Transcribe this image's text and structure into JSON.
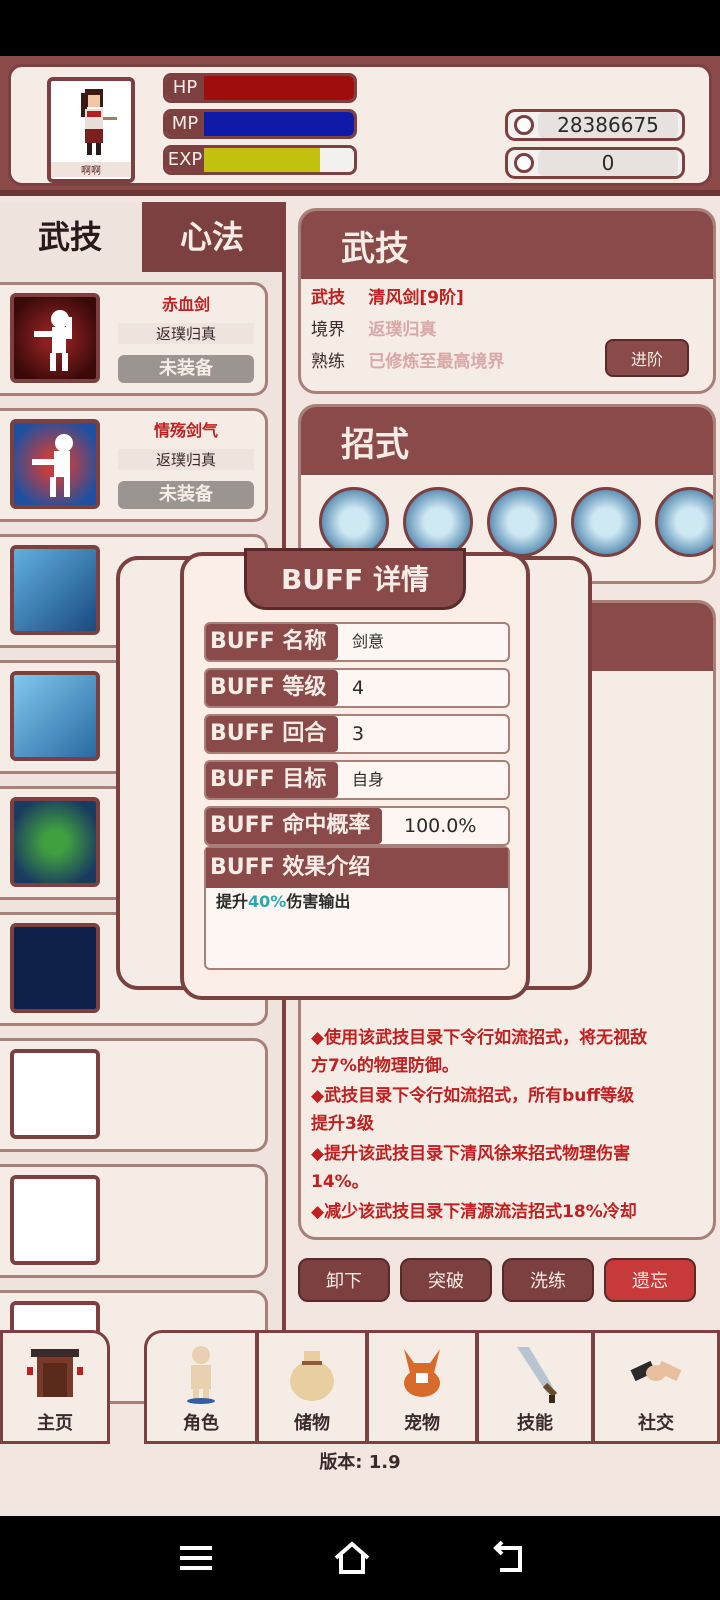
{
  "header": {
    "avatar_name": "啊啊",
    "bars": [
      {
        "label": "HP",
        "color": "#a00d0d",
        "fill": 1.0
      },
      {
        "label": "MP",
        "color": "#0f1aa8",
        "fill": 1.0
      },
      {
        "label": "EXP",
        "color": "#c3c20e",
        "fill": 0.77
      }
    ],
    "gold": "28386675",
    "gems": "0"
  },
  "left_tabs": {
    "active": "武技",
    "inactive": "心法"
  },
  "skills": [
    {
      "title": "赤血剑",
      "realm": "返璞归真",
      "status": "未装备"
    },
    {
      "title": "情殇剑气",
      "realm": "返璞归真",
      "status": "未装备"
    }
  ],
  "skill_section": {
    "heading": "武技",
    "row1_key": "武技",
    "row1_val": "清风剑[9阶]",
    "row2_key": "境界",
    "row2_val": "返璞归真",
    "row3_key": "熟练",
    "row3_val": "已修炼至最高境界",
    "upgrade": "进阶"
  },
  "moves_section": {
    "heading": "招式"
  },
  "effects": [
    "◆使用该武技目录下令行如流招式，将无视敌",
    "方7%的物理防御。",
    "◆武技目录下令行如流招式，所有buff等级",
    "提升3级",
    "◆提升该武技目录下清风徐来招式物理伤害",
    "14%。",
    "◆减少该武技目录下清源流洁招式18%冷却"
  ],
  "actions": [
    "卸下",
    "突破",
    "洗练",
    "遗忘"
  ],
  "nav": [
    "主页",
    "角色",
    "储物",
    "宠物",
    "技能",
    "社交"
  ],
  "version": "版本: 1.9",
  "buff": {
    "title": "BUFF 详情",
    "name_key": "BUFF 名称",
    "name_val": "剑意",
    "level_key": "BUFF 等级",
    "level_val": "4",
    "round_key": "BUFF 回合",
    "round_val": "3",
    "target_key": "BUFF 目标",
    "target_val": "自身",
    "hit_key": "BUFF 命中概率",
    "hit_val": "100.0%",
    "effect_key": "BUFF 效果介绍",
    "effect_pre": "提升",
    "effect_hl": "40%",
    "effect_post": "伤害输出"
  }
}
